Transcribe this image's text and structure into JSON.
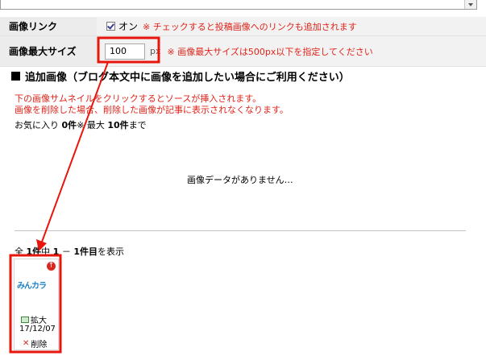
{
  "form": {
    "image_link": {
      "label": "画像リンク",
      "checkbox_checked": true,
      "option_label": "オン",
      "note": "※ チェックすると投稿画像へのリンクも追加されます"
    },
    "max_size": {
      "label": "画像最大サイズ",
      "value": "100",
      "unit": "px",
      "note": "※ 画像最大サイズは500px以下を指定してください"
    }
  },
  "section": {
    "title": "追加画像（ブログ本文中に画像を追加したい場合にご利用ください）",
    "desc_line1": "下の画像サムネイルをクリックするとソースが挿入されます。",
    "desc_line2": "画像を削除した場合、削除した画像が記事に表示されなくなります。",
    "fav_prefix": "お気に入り",
    "fav_count": "0件",
    "fav_mid": "※ 最大",
    "fav_max": "10件",
    "fav_suffix": "まで",
    "no_data": "画像データがありません…"
  },
  "pager": {
    "prefix": "全",
    "total": "1件",
    "mid": "中",
    "from": "1",
    "dash": "－",
    "to": "1件目",
    "suffix": "を表示"
  },
  "thumbnail": {
    "logo_text": "みんカラ",
    "enlarge_label": "拡大",
    "date": "17/12/07",
    "delete_label": "削除"
  },
  "colors": {
    "accent_red": "#e0241a",
    "annotation_red": "#e8150c",
    "label_bg": "#ececec",
    "value_bg": "#f2f2f2"
  },
  "icons": {
    "checkbox": "checkbox-checked-icon",
    "section": "black-square-icon",
    "upload": "red-circle-up-icon",
    "enlarge": "image-icon",
    "delete": "x-icon"
  }
}
